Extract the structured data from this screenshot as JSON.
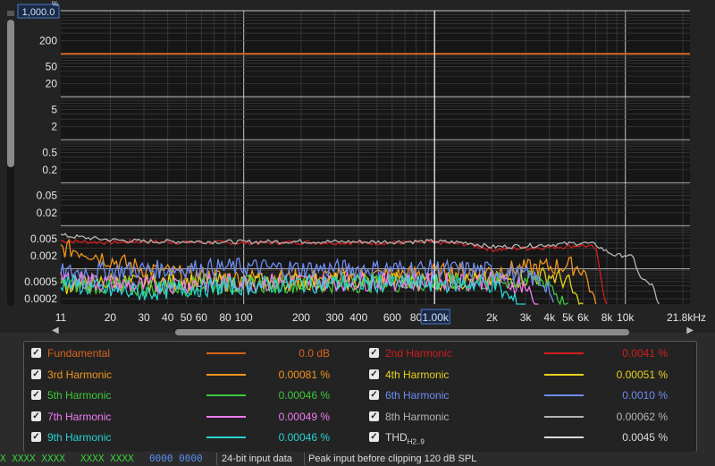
{
  "colors": {
    "background": "#161616",
    "grid": "#3c3c3c",
    "grid_major": "#c8c8c8",
    "axis_text": "#e6e6e6",
    "cursor_box": "#4b78c8"
  },
  "chart_data": {
    "type": "line",
    "x_scale": "log",
    "y_scale": "log",
    "xlim": [
      11,
      21800
    ],
    "ylim": [
      0.00015,
      1000
    ],
    "x_unit": "kHz",
    "x_ticks": [
      {
        "v": 11,
        "label": "11"
      },
      {
        "v": 20,
        "label": "20"
      },
      {
        "v": 30,
        "label": "30"
      },
      {
        "v": 40,
        "label": "40"
      },
      {
        "v": 50,
        "label": "50"
      },
      {
        "v": 60,
        "label": "60"
      },
      {
        "v": 80,
        "label": "80"
      },
      {
        "v": 100,
        "label": "100"
      },
      {
        "v": 200,
        "label": "200"
      },
      {
        "v": 300,
        "label": "300"
      },
      {
        "v": 400,
        "label": "400"
      },
      {
        "v": 600,
        "label": "600"
      },
      {
        "v": 800,
        "label": "80"
      },
      {
        "v": 2000,
        "label": "2k"
      },
      {
        "v": 3000,
        "label": "3k"
      },
      {
        "v": 4000,
        "label": "4k"
      },
      {
        "v": 5000,
        "label": "5k"
      },
      {
        "v": 6000,
        "label": "6k"
      },
      {
        "v": 8000,
        "label": "8k"
      },
      {
        "v": 10000,
        "label": "10k"
      },
      {
        "v": 21800,
        "label": "21.8kHz"
      }
    ],
    "y_ticks": [
      {
        "v": 200,
        "label": "200"
      },
      {
        "v": 50,
        "label": "50"
      },
      {
        "v": 20,
        "label": "20"
      },
      {
        "v": 5,
        "label": "5"
      },
      {
        "v": 2,
        "label": "2"
      },
      {
        "v": 0.5,
        "label": "0.5"
      },
      {
        "v": 0.2,
        "label": "0.2"
      },
      {
        "v": 0.05,
        "label": "0.05"
      },
      {
        "v": 0.02,
        "label": "0.02"
      },
      {
        "v": 0.005,
        "label": "0.005"
      },
      {
        "v": 0.002,
        "label": "0.002"
      },
      {
        "v": 0.0005,
        "label": "0.0005"
      },
      {
        "v": 0.0002,
        "label": "0.0002"
      }
    ],
    "y_top_label": "1,000.0",
    "y_unit": "%",
    "cursor_x": {
      "v": 1000,
      "label": "1.00k"
    },
    "series": [
      {
        "name": "Fundamental",
        "color": "#d4641e",
        "x": [
          11,
          21800
        ],
        "y": [
          100,
          100
        ]
      },
      {
        "name": "2nd Harmonic",
        "color": "#d21e1e",
        "x": [
          11,
          15,
          20,
          30,
          50,
          100,
          200,
          500,
          1000,
          1500,
          2000,
          3000,
          5000,
          6000,
          7000,
          7800,
          8000
        ],
        "y": [
          0.0045,
          0.0042,
          0.0041,
          0.0043,
          0.0041,
          0.004,
          0.0041,
          0.004,
          0.0041,
          0.0037,
          0.0028,
          0.003,
          0.0033,
          0.0035,
          0.003,
          0.0002,
          0.0001
        ]
      },
      {
        "name": "8th Harmonic",
        "color": "#b4b4b4",
        "x": [
          11,
          15,
          20,
          30,
          50,
          100,
          200,
          500,
          1000,
          1500,
          2000,
          3000,
          5000,
          6000,
          7000,
          8000,
          9000,
          10000,
          11000,
          12000,
          14000,
          15000
        ],
        "y": [
          0.006,
          0.0052,
          0.0047,
          0.0043,
          0.0043,
          0.0042,
          0.0043,
          0.0042,
          0.0043,
          0.004,
          0.0032,
          0.0034,
          0.0038,
          0.004,
          0.0036,
          0.0025,
          0.002,
          0.0021,
          0.0018,
          0.0006,
          0.0004,
          0.0001
        ]
      },
      {
        "name": "3rd Harmonic",
        "color": "#f0961e",
        "x": [
          11,
          15,
          20,
          30,
          50,
          100,
          200,
          500,
          1000,
          2000,
          3000,
          4000,
          5000,
          6000,
          6500,
          7000
        ],
        "y": [
          0.003,
          0.0025,
          0.0016,
          0.001,
          0.0007,
          0.0006,
          0.0006,
          0.0007,
          0.0008,
          0.0009,
          0.001,
          0.0011,
          0.0012,
          0.001,
          0.0004,
          0.0001
        ]
      },
      {
        "name": "4th Harmonic",
        "color": "#e6d21e",
        "x": [
          11,
          20,
          30,
          50,
          100,
          200,
          500,
          1000,
          2000,
          3000,
          4000,
          5000,
          5500,
          6000
        ],
        "y": [
          0.0004,
          0.0005,
          0.00045,
          0.0005,
          0.00048,
          0.0005,
          0.00052,
          0.00051,
          0.00055,
          0.0006,
          0.0007,
          0.0005,
          0.0002,
          0.0001
        ]
      },
      {
        "name": "5th Harmonic",
        "color": "#3cc83c",
        "x": [
          11,
          20,
          30,
          50,
          100,
          200,
          500,
          1000,
          2000,
          3000,
          4000,
          4500,
          5000
        ],
        "y": [
          0.00045,
          0.0004,
          0.00035,
          0.0004,
          0.00042,
          0.00045,
          0.00046,
          0.00046,
          0.0005,
          0.00055,
          0.0005,
          0.0002,
          0.0001
        ]
      },
      {
        "name": "6th Harmonic",
        "color": "#6e8cf0",
        "x": [
          11,
          20,
          30,
          50,
          100,
          200,
          500,
          1000,
          2000,
          3000,
          4000,
          4200
        ],
        "y": [
          0.0008,
          0.0009,
          0.00095,
          0.001,
          0.0011,
          0.001,
          0.001,
          0.001,
          0.0009,
          0.0007,
          0.0004,
          0.0001
        ]
      },
      {
        "name": "7th Harmonic",
        "color": "#f07cf0",
        "x": [
          11,
          20,
          30,
          50,
          100,
          200,
          500,
          1000,
          2000,
          3000,
          3500
        ],
        "y": [
          0.0006,
          0.00045,
          0.0004,
          0.00045,
          0.00048,
          0.00049,
          0.0005,
          0.00049,
          0.00052,
          0.0004,
          0.0001
        ]
      },
      {
        "name": "9th Harmonic",
        "color": "#28d2d2",
        "x": [
          11,
          20,
          30,
          50,
          100,
          200,
          500,
          1000,
          2000,
          2500,
          3000
        ],
        "y": [
          0.0005,
          0.0003,
          0.00028,
          0.00035,
          0.0004,
          0.00045,
          0.00046,
          0.00046,
          0.00045,
          0.0002,
          0.0001
        ]
      }
    ]
  },
  "legend": {
    "rows": [
      {
        "name": "Fundamental",
        "color": "#d4641e",
        "value": "0.0 dB",
        "checked": true
      },
      {
        "name": "2nd Harmonic",
        "color": "#d21e1e",
        "value": "0.0041 %",
        "checked": true
      },
      {
        "name": "3rd Harmonic",
        "color": "#f0961e",
        "value": "0.00081 %",
        "checked": true
      },
      {
        "name": "4th Harmonic",
        "color": "#e6d21e",
        "value": "0.00051 %",
        "checked": true
      },
      {
        "name": "5th Harmonic",
        "color": "#3cc83c",
        "value": "0.00046 %",
        "checked": true
      },
      {
        "name": "6th Harmonic",
        "color": "#6e8cf0",
        "value": "0.0010 %",
        "checked": true
      },
      {
        "name": "7th Harmonic",
        "color": "#f07cf0",
        "value": "0.00049 %",
        "checked": true
      },
      {
        "name": "8th Harmonic",
        "color": "#b4b4b4",
        "value": "0.00062 %",
        "checked": true
      },
      {
        "name": "9th Harmonic",
        "color": "#28d2d2",
        "value": "0.00046 %",
        "checked": true
      },
      {
        "name": "THD",
        "sub": "H2..9",
        "color": "#dcdcdc",
        "value": "0.0045 %",
        "checked": true
      }
    ]
  },
  "status": {
    "seg1": "X XXXX XXXX",
    "seg2": "XXXX XXXX",
    "seg3": "0000 0000",
    "seg4": "24-bit input data",
    "seg5": "Peak input before clipping 120 dB SPL"
  }
}
